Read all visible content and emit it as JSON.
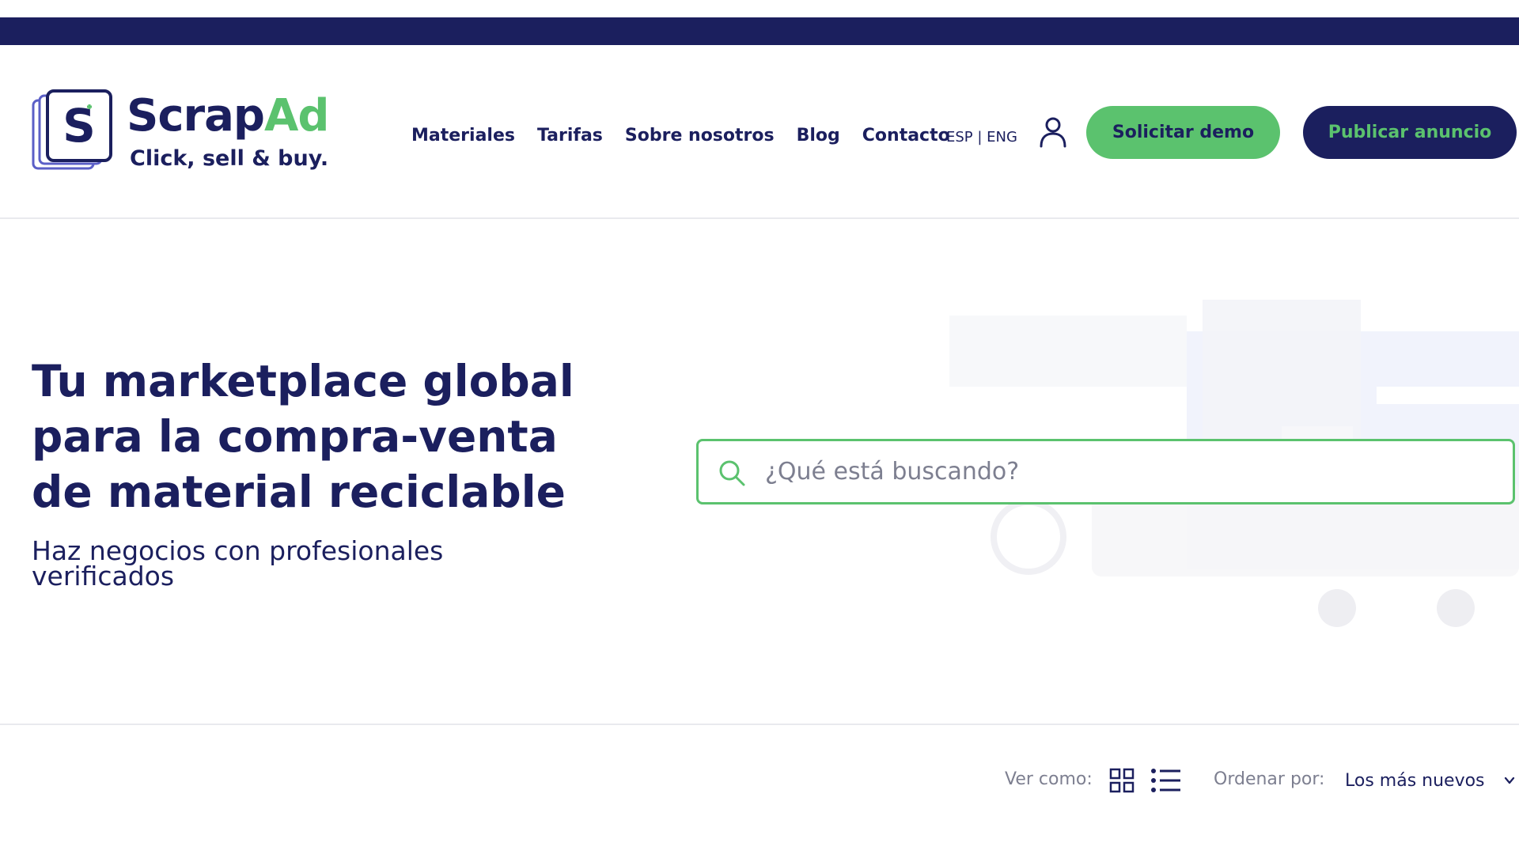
{
  "brand": {
    "name_part1": "Scrap",
    "name_part2": "Ad",
    "tagline": "Click, sell & buy.",
    "logo_letter": "S",
    "colors": {
      "navy": "#1b1f5e",
      "green": "#5bc26e"
    }
  },
  "nav": {
    "items": [
      {
        "label": "Materiales"
      },
      {
        "label": "Tarifas"
      },
      {
        "label": "Sobre nosotros"
      },
      {
        "label": "Blog"
      },
      {
        "label": "Contacto"
      }
    ],
    "language": "ESP | ENG",
    "user_icon": "user-icon"
  },
  "buttons": {
    "demo": "Solicitar demo",
    "publish": "Publicar anuncio"
  },
  "hero": {
    "title_lines": [
      "Tu marketplace global",
      "para la compra-venta",
      "de material reciclable"
    ],
    "subtitle": "Haz negocios con profesionales verificados"
  },
  "search": {
    "placeholder": "¿Qué está buscando?",
    "value": "",
    "icon": "search-icon"
  },
  "toolbar": {
    "view_label": "Ver como:",
    "view_icons": [
      "grid-icon",
      "list-icon"
    ],
    "sort_label": "Ordenar por:",
    "sort_value": "Los más nuevos",
    "sort_icon": "chevron-down-icon"
  }
}
